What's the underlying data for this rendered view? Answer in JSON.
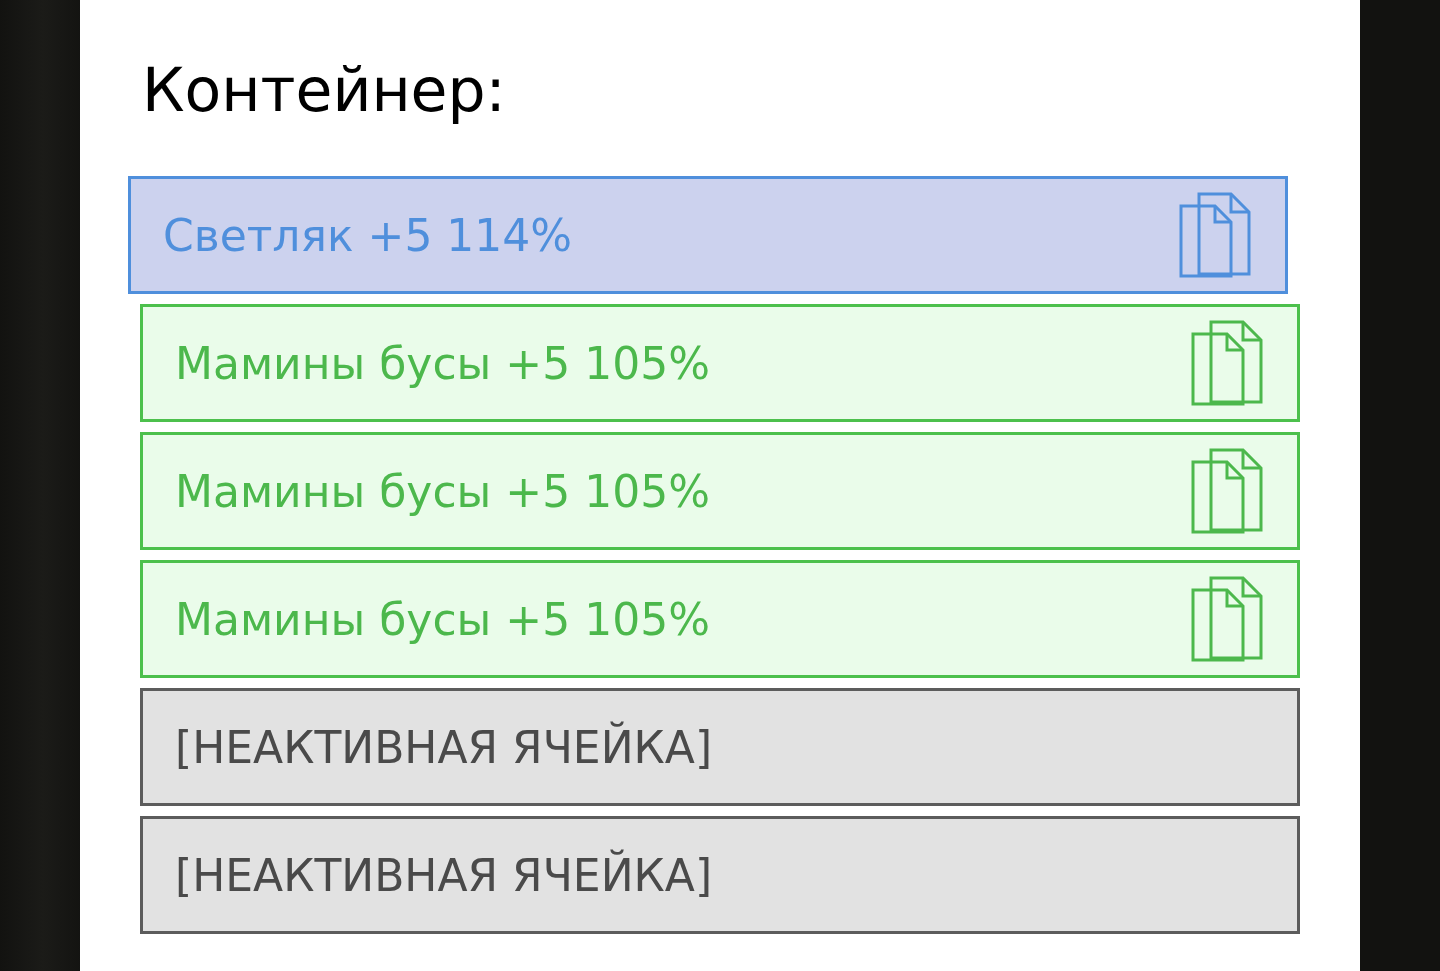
{
  "title": "Контейнер:",
  "cells": [
    {
      "kind": "highlighted",
      "label": "Светляк +5 114%"
    },
    {
      "kind": "filled",
      "label": "Мамины бусы +5 105%"
    },
    {
      "kind": "filled",
      "label": "Мамины бусы +5 105%"
    },
    {
      "kind": "filled",
      "label": "Мамины бусы +5 105%"
    },
    {
      "kind": "empty",
      "label": "[НЕАКТИВНАЯ ЯЧЕЙКА]"
    },
    {
      "kind": "empty",
      "label": "[НЕАКТИВНАЯ ЯЧЕЙКА]"
    }
  ]
}
